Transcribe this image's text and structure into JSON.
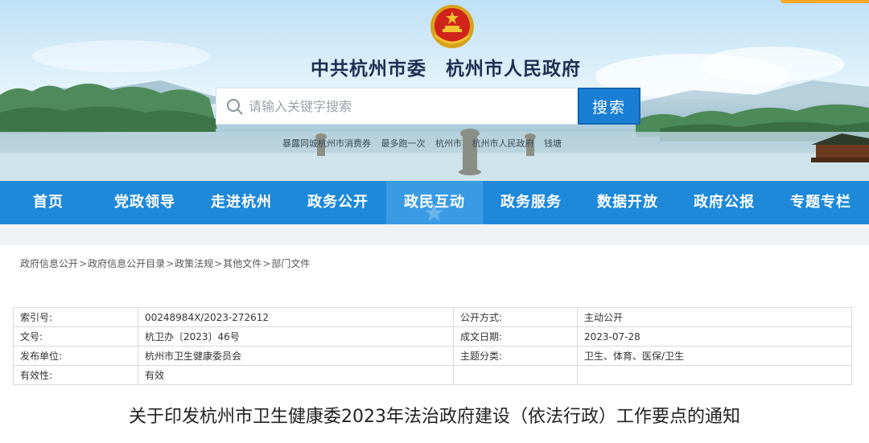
{
  "banner": {
    "site_title": "中共杭州市委　杭州市人民政府",
    "search": {
      "placeholder": "请输入关键字搜索",
      "button_label": "搜索"
    },
    "hot_links": [
      "暴露同城杭州市消费券",
      "最多跑一次",
      "杭州市",
      "杭州市人民政府",
      "钱塘"
    ]
  },
  "nav": {
    "items": [
      {
        "label": "首页"
      },
      {
        "label": "党政领导"
      },
      {
        "label": "走进杭州"
      },
      {
        "label": "政务公开"
      },
      {
        "label": "政民互动"
      },
      {
        "label": "政务服务"
      },
      {
        "label": "数据开放"
      },
      {
        "label": "政府公报"
      },
      {
        "label": "专题专栏"
      }
    ],
    "active_index": 4
  },
  "breadcrumb": {
    "items": [
      "政府信息公开",
      "政府信息公开目录",
      "政策法规",
      "其他文件",
      "部门文件"
    ],
    "separator": ">"
  },
  "info": {
    "rows": [
      {
        "k1": "索引号:",
        "v1": "00248984X/2023-272612",
        "k2": "公开方式:",
        "v2": "主动公开"
      },
      {
        "k1": "文号:",
        "v1": "杭卫办〔2023〕46号",
        "k2": "成文日期:",
        "v2": "2023-07-28"
      },
      {
        "k1": "发布单位:",
        "v1": "杭州市卫生健康委员会",
        "k2": "主题分类:",
        "v2": "卫生、体育、医保/卫生"
      },
      {
        "k1": "有效性:",
        "v1": "有效",
        "k2": "",
        "v2": ""
      }
    ]
  },
  "document": {
    "title": "关于印发杭州市卫生健康委2023年法治政府建设（依法行政）工作要点的通知"
  },
  "colors": {
    "nav_bg": "#1e88d9",
    "nav_active": "#3a9be4",
    "search_button": "#1a7fd4",
    "title_color": "#1f2f52"
  }
}
